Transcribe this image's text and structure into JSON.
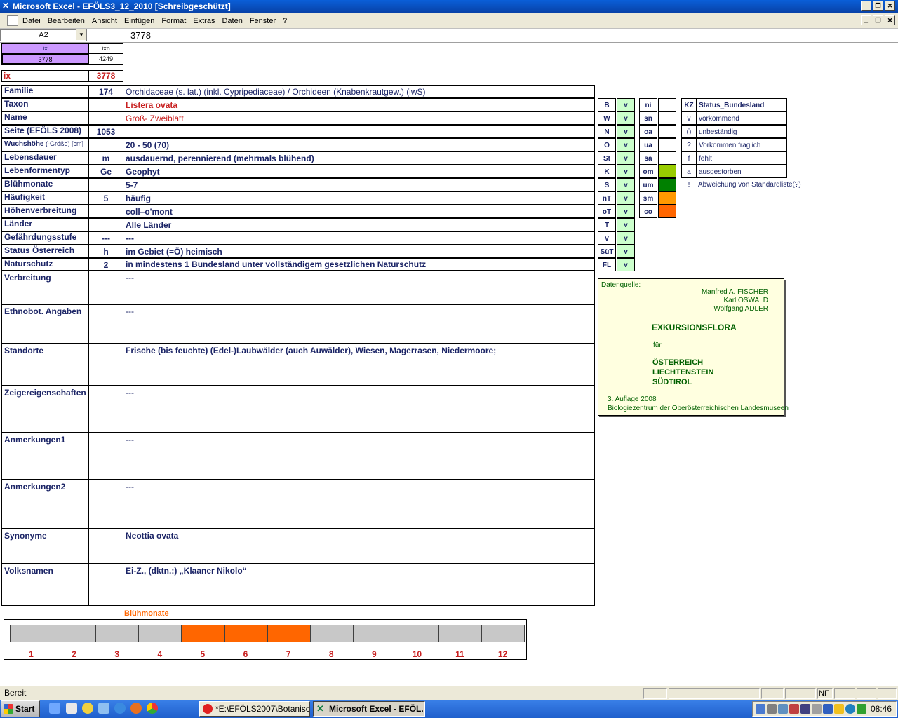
{
  "window": {
    "title": "Microsoft Excel - EFÖLS3_12_2010  [Schreibgeschützt]"
  },
  "menu": [
    "Datei",
    "Bearbeiten",
    "Ansicht",
    "Einfügen",
    "Format",
    "Extras",
    "Daten",
    "Fenster",
    "?"
  ],
  "formula_bar": {
    "cell_ref": "A2",
    "equals": "=",
    "value": "3778"
  },
  "index_box": {
    "headers": [
      "ix",
      "ixn"
    ],
    "values": [
      "3778",
      "4249"
    ],
    "ix_label": "ix",
    "ix_value": "3778"
  },
  "rows": [
    {
      "label": "Familie",
      "code": "174",
      "value": "Orchidaceae (s. lat.) (inkl. Cypripediaceae)  /  Orchideen (Knabenkrautgew.) (iwS)"
    },
    {
      "label": "Taxon",
      "code": "",
      "value": "Listera ovata"
    },
    {
      "label": "Name",
      "code": "",
      "value": "Groß- Zweiblatt"
    },
    {
      "label": "Seite (EFÖLS 2008)",
      "code": "1053",
      "value": ""
    },
    {
      "label": "Wuchshöhe",
      "label_suffix": " (-Größe) [cm]",
      "code": "",
      "value": " 20 - 50 (70)"
    },
    {
      "label": "Lebensdauer",
      "code": "m",
      "value": "ausdauernd, perennierend (mehrmals blühend)"
    },
    {
      "label": "Lebenformentyp",
      "code": "Ge",
      "value": "Geophyt"
    },
    {
      "label": "Blühmonate",
      "code": "",
      "value": " 5-7"
    },
    {
      "label": "Häufigkeit",
      "code": "5",
      "value": "häufig"
    },
    {
      "label": "Höhenverbreitung",
      "code": "",
      "value": "coll–o'mont"
    },
    {
      "label": "Länder",
      "code": "",
      "value": "Alle Länder"
    },
    {
      "label": "Gefährdungsstufe",
      "code": "---",
      "value": " ---"
    },
    {
      "label": "Status Österreich",
      "code": "h",
      "value": "im Gebiet (=Ö) heimisch"
    },
    {
      "label": "Naturschutz",
      "code": "2",
      "value": "in mindestens 1 Bundesland unter vollständigem gesetzlichen Naturschutz"
    }
  ],
  "tall_rows": [
    {
      "label": "Verbreitung",
      "value": " ---"
    },
    {
      "label": "Ethnobot. Angaben",
      "value": "---"
    },
    {
      "label": "Standorte",
      "value": "Frische (bis feuchte) (Edel-)Laubwälder (auch Auwälder), Wiesen, Magerrasen, Niedermoore;"
    },
    {
      "label": "Zeigereigenschaften",
      "value": "---"
    },
    {
      "label": "Anmerkungen1",
      "value": "---"
    },
    {
      "label": "Anmerkungen2",
      "value": "---"
    },
    {
      "label": "Synonyme",
      "value": "Neottia ovata"
    },
    {
      "label": "Volksnamen",
      "value": "Ei-Z., (dktn.:) „Klaaner Nikolo“"
    }
  ],
  "states": [
    {
      "code": "B",
      "status": "v"
    },
    {
      "code": "W",
      "status": "v"
    },
    {
      "code": "N",
      "status": "v"
    },
    {
      "code": "O",
      "status": "v"
    },
    {
      "code": "St",
      "status": "v"
    },
    {
      "code": "K",
      "status": "v"
    },
    {
      "code": "S",
      "status": "v"
    },
    {
      "code": "nT",
      "status": "v"
    },
    {
      "code": "oT",
      "status": "v"
    },
    {
      "code": "T",
      "status": "v"
    },
    {
      "code": "V",
      "status": "v"
    },
    {
      "code": "SüT",
      "status": "v"
    },
    {
      "code": "FL",
      "status": "v"
    }
  ],
  "altitude_legend": [
    {
      "code": "ni",
      "color": "#ffffff"
    },
    {
      "code": "sn",
      "color": "#ffffff"
    },
    {
      "code": "oa",
      "color": "#ffffff"
    },
    {
      "code": "ua",
      "color": "#ffffff"
    },
    {
      "code": "sa",
      "color": "#ffffff"
    },
    {
      "code": "om",
      "color": "#99cc00"
    },
    {
      "code": "um",
      "color": "#008000"
    },
    {
      "code": "sm",
      "color": "#ff9900"
    },
    {
      "code": "co",
      "color": "#ff6600"
    }
  ],
  "status_legend": {
    "header_code": "KZ",
    "header_text": "Status_Bundesland",
    "items": [
      {
        "code": "v",
        "text": "vorkommend"
      },
      {
        "code": "()",
        "text": "unbeständig"
      },
      {
        "code": "?",
        "text": "Vorkommen fraglich"
      },
      {
        "code": "f",
        "text": "fehlt"
      },
      {
        "code": "a",
        "text": "ausgestorben"
      },
      {
        "code": "!",
        "text": "Abweichung von Standardliste(?)"
      }
    ]
  },
  "source": {
    "label": "Datenquelle:",
    "authors": [
      "Manfred A. FISCHER",
      "Karl OSWALD",
      "Wolfgang ADLER"
    ],
    "title": "EXKURSIONSFLORA",
    "fuer": "für",
    "regions": [
      "ÖSTERREICH",
      "LIECHTENSTEIN",
      "SÜDTIROL"
    ],
    "edition": "3. Auflage 2008",
    "publisher": "Biologiezentrum der Oberösterreichischen Landesmuseen"
  },
  "bloom": {
    "title": "Blühmonate",
    "months": [
      "1",
      "2",
      "3",
      "4",
      "5",
      "6",
      "7",
      "8",
      "9",
      "10",
      "11",
      "12"
    ],
    "active": [
      5,
      6,
      7
    ],
    "active_color": "#ff6600",
    "inactive_color": "#c8c8c8"
  },
  "statusbar": {
    "text": "Bereit",
    "nf": "NF"
  },
  "taskbar": {
    "start": "Start",
    "items": [
      "*E:\\EFÖLS2007\\Botanisc...",
      "Microsoft Excel - EFÖL..."
    ],
    "clock": "08:46"
  }
}
